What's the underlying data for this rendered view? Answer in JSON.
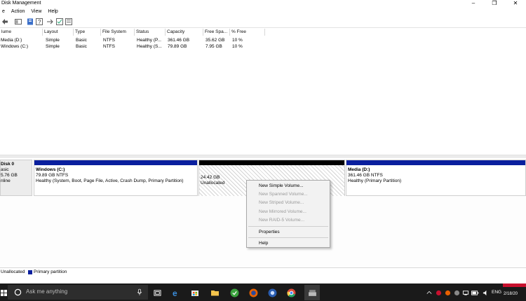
{
  "window": {
    "title": "Disk Management",
    "controls": {
      "minimize": "–",
      "restore": "❐",
      "close": "✕"
    }
  },
  "menu": [
    "e",
    "Action",
    "View",
    "Help"
  ],
  "columns": [
    "lume",
    "Layout",
    "Type",
    "File System",
    "Status",
    "Capacity",
    "Free Spa...",
    "% Free"
  ],
  "volumes": [
    [
      "Media (D:)",
      "Simple",
      "Basic",
      "NTFS",
      "Healthy (P...",
      "361.46 GB",
      "35.62 GB",
      "10 %"
    ],
    [
      "Windows (C:)",
      "Simple",
      "Basic",
      "NTFS",
      "Healthy (S...",
      "79.89 GB",
      "7.95 GB",
      "10 %"
    ]
  ],
  "disk": {
    "name": "Disk 0",
    "type": "asic",
    "size": "5.76 GB",
    "state": "nline"
  },
  "partitions": [
    {
      "title": "Windows (C:)",
      "size": "79.89 GB NTFS",
      "status": "Healthy (System, Boot, Page File, Active, Crash Dump, Primary Partition)"
    },
    {
      "title": "",
      "size": "24.42 GB",
      "status": "Unallocated"
    },
    {
      "title": "Media (D:)",
      "size": "361.46 GB NTFS",
      "status": "Healthy (Primary Partition)"
    }
  ],
  "context_menu": {
    "items": [
      {
        "label": "New Simple Volume...",
        "enabled": true
      },
      {
        "label": "New Spanned Volume...",
        "enabled": false
      },
      {
        "label": "New Striped Volume...",
        "enabled": false
      },
      {
        "label": "New Mirrored Volume...",
        "enabled": false
      },
      {
        "label": "New RAID-5 Volume...",
        "enabled": false
      },
      {
        "label": "Properties",
        "enabled": true
      },
      {
        "label": "Help",
        "enabled": true
      }
    ]
  },
  "legend": {
    "unallocated": "Unallocated",
    "primary": "Primary partition"
  },
  "taskbar": {
    "search_placeholder": "Ask me anything",
    "language": "ENG",
    "time": "",
    "date": "2/18/20"
  },
  "colors": {
    "primary_partition": "#0a1f9e",
    "unallocated_bar": "#000000",
    "taskbar": "#1a1a1a"
  }
}
